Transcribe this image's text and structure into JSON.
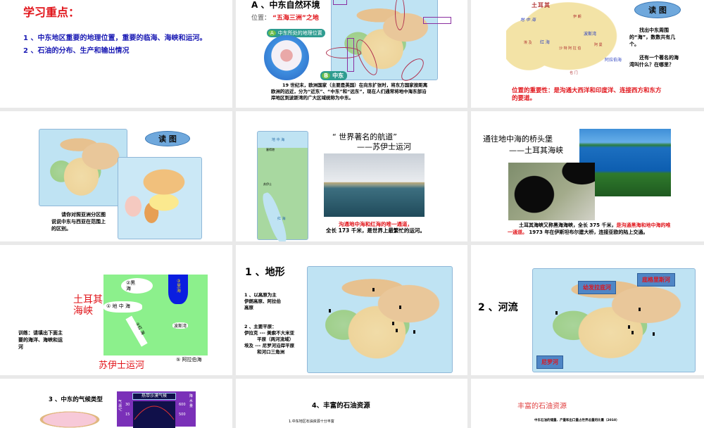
{
  "slides": [
    {
      "title": "学习重点：",
      "points": [
        "1 、中东地区重要的地理位置，重要的临海、海峡和运河。",
        "2 、石油的分布、生产和输出情况"
      ]
    },
    {
      "title": "A 、中东自然环境",
      "position_label": "位置：",
      "position_value": "“五海三洲”之地",
      "badge_a": "A",
      "badge_a_text": "中东所处的地理位置",
      "badge_b": "B",
      "badge_b_text": "中东",
      "paragraph": "19 世纪末，欧洲国家（主要是英国）在向东扩张时，将东方国家按距离欧洲的远近，分为“近东”、“中东”和“远东”，现在人们通常将地中海东部沿岸地区到波斯湾的广大区域统称为中东。"
    },
    {
      "cloud": "读 图",
      "q1": "找出中东周围的“海”，数数共有几个。",
      "q2": "还有一个著名的海湾叫什么？在哪里？",
      "importance": "位置的重要性：是沟通大西洋和印度洋、连接西方和东方的要道。",
      "map_labels": [
        "地 中 海",
        "红 海",
        "波斯湾",
        "阿拉伯海",
        "土耳其",
        "伊 朗",
        "埃 及",
        "沙 特 阿 拉 伯",
        "也 门",
        "阿 曼"
      ]
    },
    {
      "cloud": "读 图",
      "text": "请你对照亚洲分区图说说中东与西亚在范围上的区别。"
    },
    {
      "title1": "“ 世界著名的航道”",
      "title2": "——苏伊士运河",
      "red_text": "沟通地中海和红海的唯一通道，",
      "text": "全长 173 千米，是世界上最繁忙的运河。",
      "map_labels": [
        "地 中 海",
        "塞得港",
        "苏伊士",
        "红 海"
      ]
    },
    {
      "title1": "通往地中海的桥头堡",
      "title2": "——土耳其海峡",
      "text_a": "土耳其海峡又称黑海海峡，全长 375 千米，",
      "text_red": "是沟通黑海和地中海的唯一通道。",
      "text_b": " 1973 年在伊斯坦布尔建大桥，连接亚欧的陆上交通。"
    },
    {
      "strait": "土耳其\n海峡",
      "canal": "苏伊士运河",
      "exercise": "训练：请填出下面主要的海洋、海峡和运河",
      "labels": {
        "black_sea": "②黑\n海",
        "med": "① 地 中 海",
        "caspian": "③\n里\n海",
        "red_sea": "④红 海",
        "gulf": "波斯湾",
        "arabian": "⑤ 阿拉伯海"
      }
    },
    {
      "title": "1 、地形",
      "p1": "1 、以高原为主\n伊朗高原、阿拉伯\n高原",
      "p2": "2 、主要平原：\n伊拉克 --- 美索不大米亚\n        平原（两河流域）\n埃及 --- 尼罗河沿岸平原\n        和河口三角洲"
    },
    {
      "title": "2 、河流",
      "rivers": [
        "幼发拉底河",
        "底格里斯河",
        "尼罗河"
      ]
    },
    {
      "title": "3 、中东的气候类型",
      "chart_title": "热带沙漠气候",
      "left_axis": "气\n温\n℃",
      "right_axis": "降\n水\n量",
      "ticks_left": [
        "30",
        "15"
      ],
      "ticks_right": [
        "600",
        "500"
      ]
    },
    {
      "title": "4、丰富的石油资源",
      "sub": "1.中东地区石油资源十分丰富"
    },
    {
      "title": "丰富的石油资源",
      "sub": "中东石油的储量、产量和出口量占世界总量的比重（2010）"
    }
  ]
}
